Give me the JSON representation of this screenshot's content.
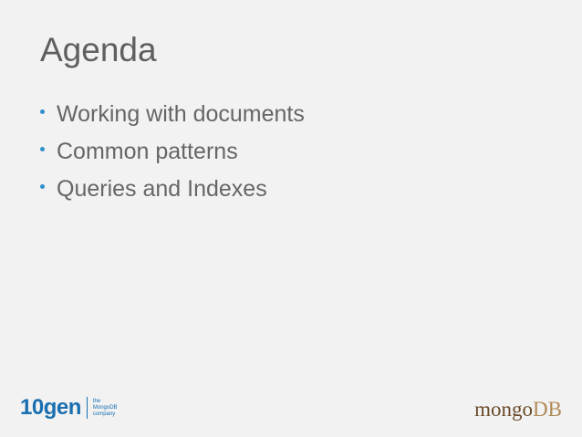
{
  "slide": {
    "title": "Agenda",
    "bullets": [
      "Working with documents",
      "Common patterns",
      "Queries and Indexes"
    ]
  },
  "logos": {
    "left": {
      "word": "10gen",
      "tagline": [
        "the",
        "MongoDB",
        "company"
      ],
      "color": "#1a6fb0"
    },
    "right": {
      "mongo": "mongo",
      "db": "DB",
      "mongo_color": "#6b4a2a",
      "db_color": "#b08a57"
    }
  },
  "colors": {
    "background": "#f2f2f2",
    "bullet": "#2f8fc9",
    "text": "#666666"
  }
}
